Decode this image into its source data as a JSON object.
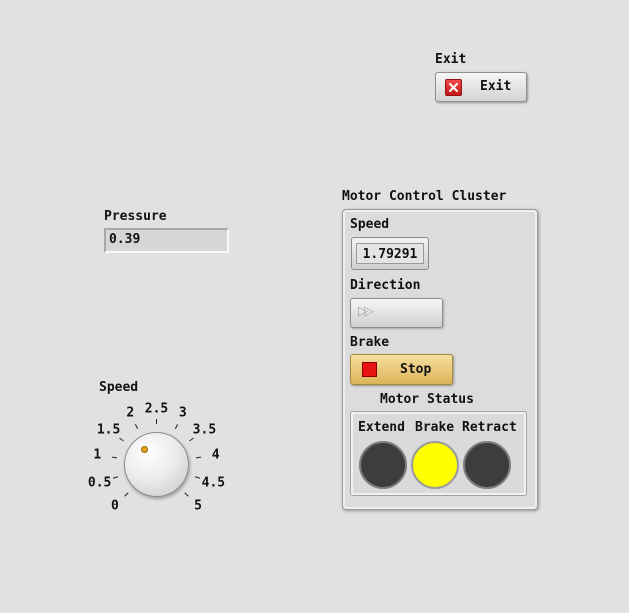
{
  "exit": {
    "label_above": "Exit",
    "button_label": "Exit"
  },
  "pressure": {
    "label": "Pressure",
    "value": "0.39"
  },
  "speed_knob": {
    "label": "Speed",
    "min": 0,
    "max": 5,
    "value": 0.95,
    "scale": [
      "0",
      "0.5",
      "1",
      "1.5",
      "2",
      "2.5",
      "3",
      "3.5",
      "4",
      "4.5",
      "5"
    ],
    "indicator_color": "#e0a11d"
  },
  "cluster": {
    "title": "Motor Control Cluster",
    "speed_label": "Speed",
    "speed_value": "1.79291",
    "direction_label": "Direction",
    "direction_icon": "fast-forward-icon",
    "brake_label": "Brake",
    "brake_button": "Stop",
    "motor_status": {
      "title": "Motor Status",
      "leds": [
        {
          "label": "Extend",
          "on": false,
          "color": "#3d3d3d"
        },
        {
          "label": "Brake",
          "on": true,
          "color": "#ffff00"
        },
        {
          "label": "Retract",
          "on": false,
          "color": "#3d3d3d"
        }
      ]
    }
  }
}
